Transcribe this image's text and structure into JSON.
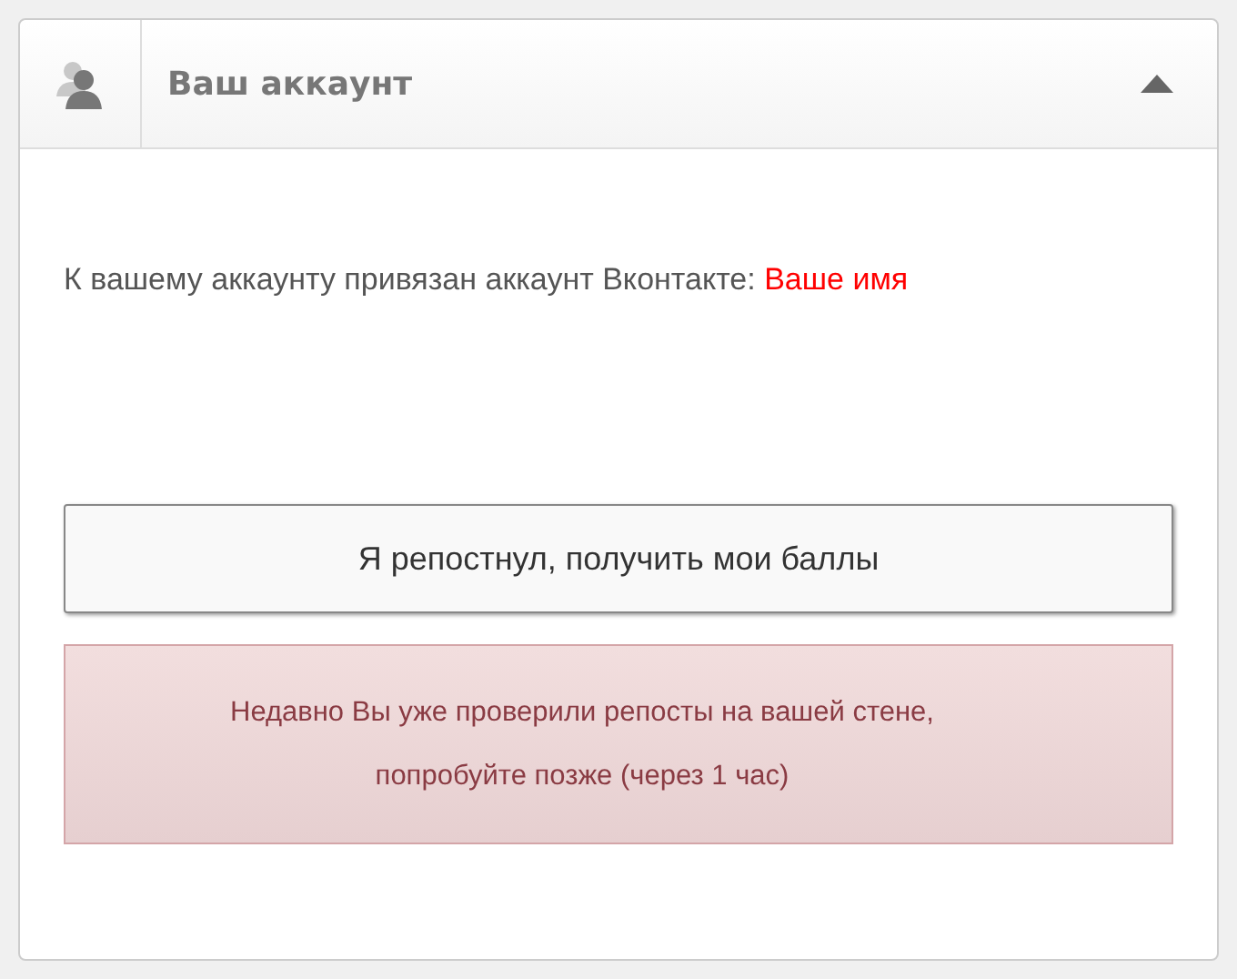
{
  "panel": {
    "title": "Ваш аккаунт",
    "expanded": true
  },
  "linked_text": "К вашему аккаунту привязан аккаунт Вконтакте:",
  "linked_name": "Ваше имя",
  "button": "Я репостнул, получить мои баллы",
  "alert": "Недавно Вы уже проверили репосты на вашей стене,\nпопробуйте позже (через 1 час)"
}
